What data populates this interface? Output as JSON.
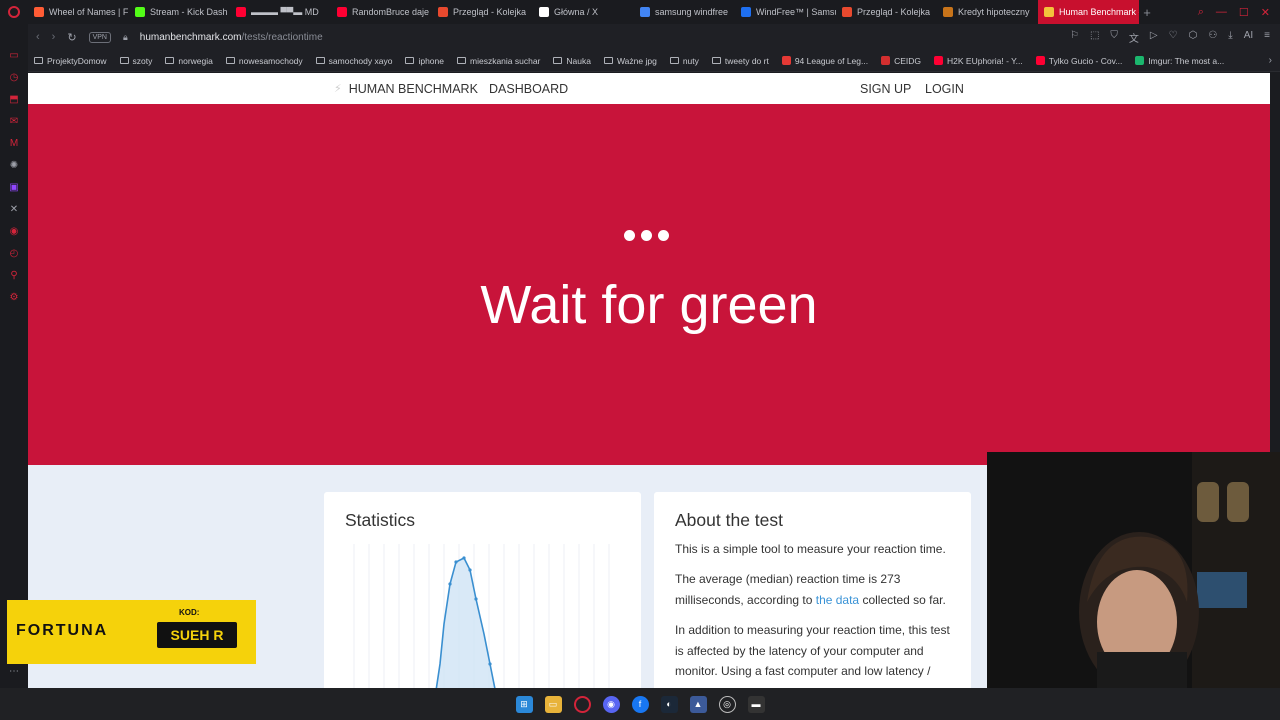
{
  "browser": {
    "tabs": [
      {
        "label": "Wheel of Names | F",
        "color": "#ff5c35",
        "active": false
      },
      {
        "label": "Stream - Kick Dash",
        "color": "#53fc18",
        "active": false
      },
      {
        "label": "▬▬▬ ▀▀▬ MD",
        "color": "#ff0033",
        "active": false
      },
      {
        "label": "RandomBruce daje",
        "color": "#ff0033",
        "active": false
      },
      {
        "label": "Przegląd - Kolejka",
        "color": "#e8492e",
        "active": false
      },
      {
        "label": "Główna / X",
        "color": "#ffffff",
        "active": false
      },
      {
        "label": "samsung windfree",
        "color": "#4285f4",
        "active": false
      },
      {
        "label": "WindFree™ | Samsu",
        "color": "#1e6ff0",
        "active": false
      },
      {
        "label": "Przegląd - Kolejka",
        "color": "#e8492e",
        "active": false
      },
      {
        "label": "Kredyt hipoteczny",
        "color": "#c8741a",
        "active": false
      },
      {
        "label": "Human Benchmark - Reac",
        "color": "#f3c33c",
        "active": true
      }
    ],
    "new_tab": "+",
    "url_host": "humanbenchmark.com",
    "url_path": "/tests/reactiontime",
    "vpn_label": "VPN",
    "ai_label": "AI",
    "bookmarks": [
      {
        "label": "ProjektyDomow",
        "kind": "folder"
      },
      {
        "label": "szoty",
        "kind": "folder"
      },
      {
        "label": "norwegia",
        "kind": "folder"
      },
      {
        "label": "nowesamochody",
        "kind": "folder"
      },
      {
        "label": "samochody xayo",
        "kind": "folder"
      },
      {
        "label": "iphone",
        "kind": "folder"
      },
      {
        "label": "mieszkania suchar",
        "kind": "folder"
      },
      {
        "label": "Nauka",
        "kind": "folder"
      },
      {
        "label": "Ważne jpg",
        "kind": "folder"
      },
      {
        "label": "nuty",
        "kind": "folder"
      },
      {
        "label": "tweety do rt",
        "kind": "folder"
      },
      {
        "label": "94 League of Leg...",
        "kind": "site",
        "color": "#e53935"
      },
      {
        "label": "CEIDG",
        "kind": "site",
        "color": "#d32f2f"
      },
      {
        "label": "H2K EUphoria! - Y...",
        "kind": "site",
        "color": "#ff0033"
      },
      {
        "label": "Tylko Gucio - Cov...",
        "kind": "site",
        "color": "#ff0033"
      },
      {
        "label": "Imgur: The most a...",
        "kind": "site",
        "color": "#1bb76e"
      }
    ]
  },
  "site": {
    "brand": "HUMAN BENCHMARK",
    "dashboard": "DASHBOARD",
    "signup": "SIGN UP",
    "login": "LOGIN"
  },
  "test": {
    "instruction": "Wait for green",
    "background": "#c8143a"
  },
  "statistics": {
    "title": "Statistics"
  },
  "about": {
    "title": "About the test",
    "p1": "This is a simple tool to measure your reaction time.",
    "p2_before": "The average (median) reaction time is 273 milliseconds, according to ",
    "p2_link": "the data",
    "p2_after": " collected so far.",
    "p3": "In addition to measuring your reaction time, this test is affected by the latency of your computer and monitor. Using a fast computer and low latency /"
  },
  "overlay": {
    "sponsor": "FORTUNA",
    "code_label": "KOD:",
    "code_value": "SUEH R"
  }
}
